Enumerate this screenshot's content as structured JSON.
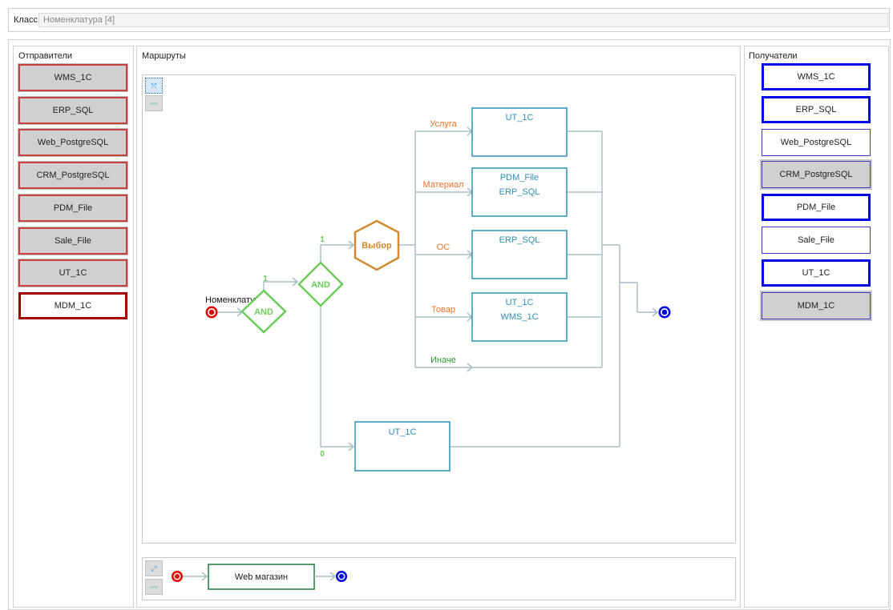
{
  "header": {
    "class_label": "Класс",
    "class_value": "Номенклатура [4]"
  },
  "senders": {
    "title": "Отправители",
    "items": [
      {
        "label": "WMS_1C",
        "state": "normal"
      },
      {
        "label": "ERP_SQL",
        "state": "normal"
      },
      {
        "label": "Web_PostgreSQL",
        "state": "normal"
      },
      {
        "label": "CRM_PostgreSQL",
        "state": "normal"
      },
      {
        "label": "PDM_File",
        "state": "normal"
      },
      {
        "label": "Sale_File",
        "state": "normal"
      },
      {
        "label": "UT_1C",
        "state": "normal"
      },
      {
        "label": "MDM_1C",
        "state": "selected"
      }
    ]
  },
  "routes": {
    "title": "Маршруты",
    "diagram": {
      "source_label": "Номенклатура",
      "and1": "AND",
      "and2": "AND",
      "and1_out": "1",
      "and2_out_true": "1",
      "and2_out_false": "0",
      "choice": "Выбор",
      "branches": [
        {
          "label": "Услуга",
          "targets": [
            "UT_1C"
          ]
        },
        {
          "label": "Материал",
          "targets": [
            "PDM_File",
            "ERP_SQL"
          ]
        },
        {
          "label": "ОС",
          "targets": [
            "ERP_SQL"
          ]
        },
        {
          "label": "Товар",
          "targets": [
            "UT_1C",
            "WMS_1C"
          ]
        },
        {
          "label": "Иначе",
          "targets": []
        }
      ],
      "false_target": "UT_1C"
    },
    "secondary": {
      "node": "Web магазин"
    },
    "tools": {
      "fit": "fit-icon",
      "connect": "connector-icon"
    }
  },
  "receivers": {
    "title": "Получатели",
    "items": [
      {
        "label": "WMS_1C",
        "state": "thick"
      },
      {
        "label": "ERP_SQL",
        "state": "thick"
      },
      {
        "label": "Web_PostgreSQL",
        "state": "thin"
      },
      {
        "label": "CRM_PostgreSQL",
        "state": "gray"
      },
      {
        "label": "PDM_File",
        "state": "thick"
      },
      {
        "label": "Sale_File",
        "state": "thin"
      },
      {
        "label": "UT_1C",
        "state": "thick"
      },
      {
        "label": "MDM_1C",
        "state": "gray"
      }
    ]
  },
  "colors": {
    "start": "#e00000",
    "end": "#0000e0",
    "gate": "#6ccc5a",
    "choice": "#d08a30",
    "box": "#2f8fb5",
    "line": "#a9bfc9",
    "branch_label": "#e8732c",
    "else_label": "#2a9a2a"
  }
}
